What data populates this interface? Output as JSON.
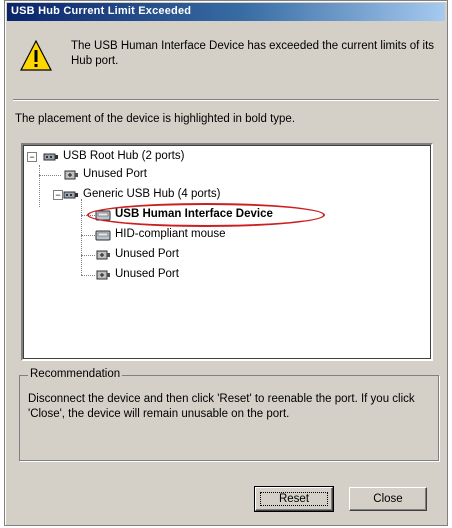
{
  "window": {
    "title": "USB Hub Current Limit Exceeded"
  },
  "message": "The USB Human Interface Device has exceeded the current limits of its Hub port.",
  "placement_text": "The placement of the device is highlighted in bold type.",
  "tree": {
    "nodes": [
      {
        "label": "USB Root Hub (2 ports)",
        "icon": "usb-hub-icon",
        "expander": "−"
      },
      {
        "label": "Unused Port",
        "icon": "usb-port-icon"
      },
      {
        "label": "Generic USB Hub (4 ports)",
        "icon": "usb-hub-icon",
        "expander": "−"
      },
      {
        "label": "USB Human Interface Device",
        "icon": "hid-device-icon",
        "bold": true
      },
      {
        "label": "HID-compliant mouse",
        "icon": "mouse-device-icon"
      },
      {
        "label": "Unused Port",
        "icon": "usb-port-icon"
      },
      {
        "label": "Unused Port",
        "icon": "usb-port-icon"
      }
    ]
  },
  "recommendation": {
    "title": "Recommendation",
    "text": "Disconnect the device and then click 'Reset' to reenable the port. If you click 'Close', the device will remain unusable on the port."
  },
  "buttons": {
    "reset": "Reset",
    "close": "Close"
  },
  "colors": {
    "highlight": "#cc2020",
    "titlebar_start": "#0a246a",
    "face": "#d4d0c8"
  }
}
